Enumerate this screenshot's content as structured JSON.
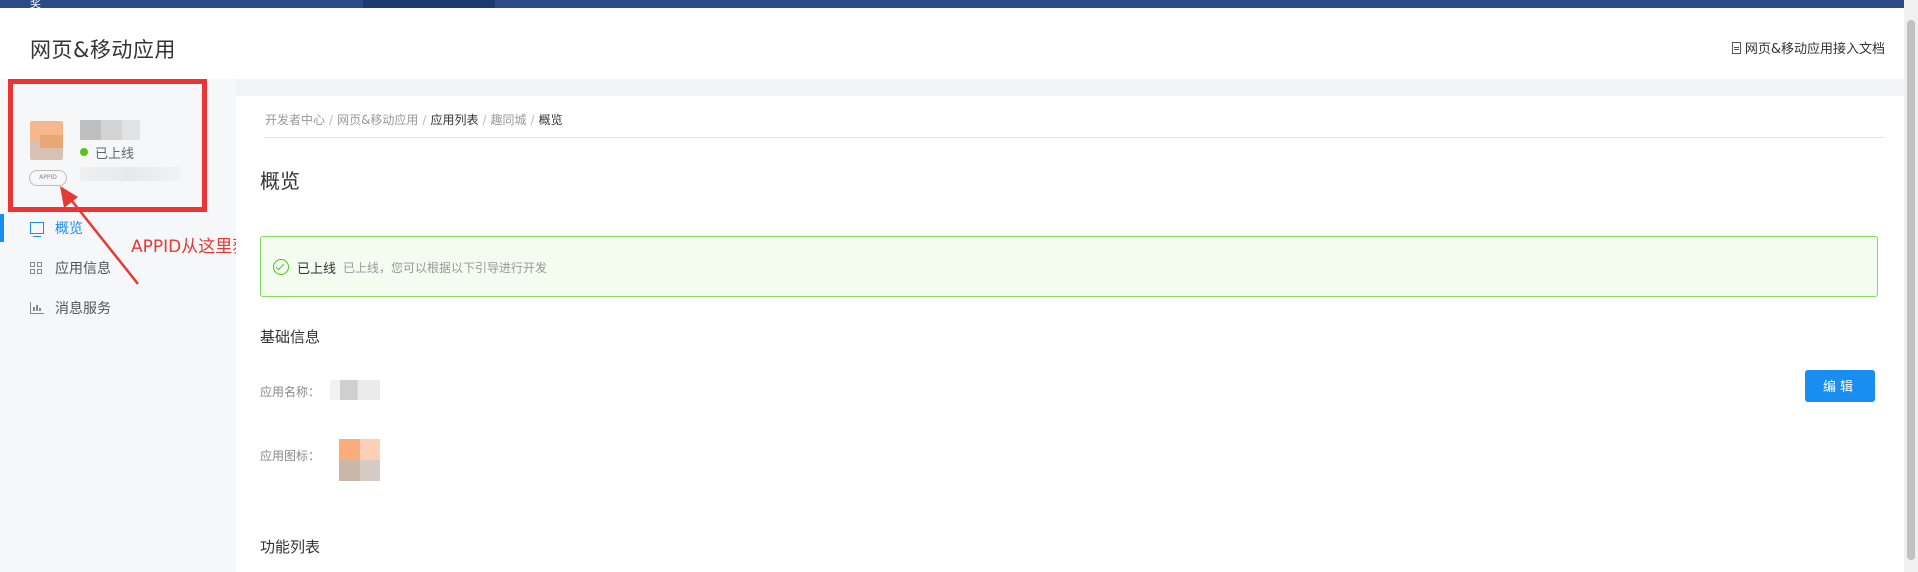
{
  "topnav": {
    "glyph": "奖"
  },
  "header": {
    "title": "网页&移动应用",
    "doc_link": "网页&移动应用接入文档"
  },
  "sidebar": {
    "app_status": "已上线",
    "appid_badge": "APPID",
    "nav": [
      {
        "label": "概览",
        "icon": "overview-icon",
        "active": true
      },
      {
        "label": "应用信息",
        "icon": "grid-icon",
        "active": false
      },
      {
        "label": "消息服务",
        "icon": "chart-icon",
        "active": false
      }
    ]
  },
  "annotation": {
    "text": "APPID从这里获取",
    "color": "#e53935"
  },
  "breadcrumb": [
    {
      "label": "开发者中心",
      "current": false
    },
    {
      "label": "网页&移动应用",
      "current": false
    },
    {
      "label": "应用列表",
      "current": true
    },
    {
      "label": "趣同城",
      "current": false
    },
    {
      "label": "概览",
      "current": true
    }
  ],
  "main": {
    "title": "概览",
    "alert": {
      "title": "已上线",
      "desc": "已上线，您可以根据以下引导进行开发"
    },
    "basic_info": {
      "title": "基础信息",
      "name_label": "应用名称：",
      "icon_label": "应用图标：",
      "edit_button": "编辑"
    },
    "features_title": "功能列表"
  },
  "colors": {
    "accent": "#1a8df0",
    "success": "#52c41a",
    "highlight": "#ee3333",
    "topnav": "#2b4a86"
  }
}
